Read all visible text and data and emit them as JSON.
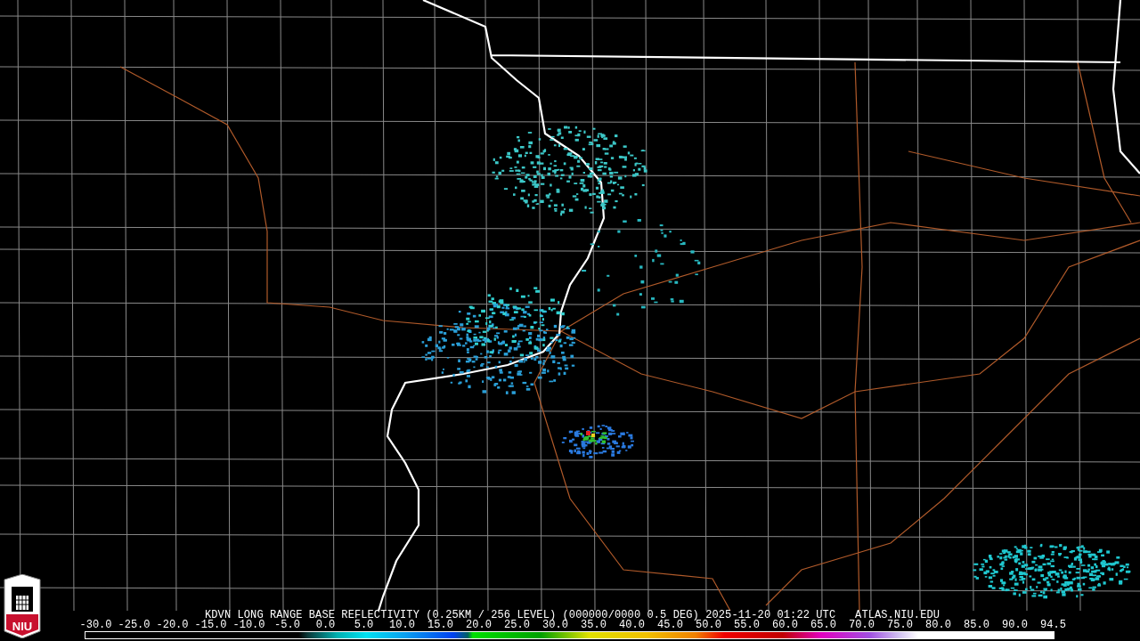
{
  "logo": {
    "text": "NIU"
  },
  "caption": "KDVN LONG RANGE BASE REFLECTIVITY (0.25KM / 256 LEVEL) (000000/0000 0.5 DEG) 2025-11-20 01:22 UTC   ATLAS.NIU.EDU",
  "scale": {
    "ticks": [
      "-30.0",
      "-25.0",
      "-20.0",
      "-15.0",
      "-10.0",
      "-5.0",
      "0.0",
      "5.0",
      "10.0",
      "15.0",
      "20.0",
      "25.0",
      "30.0",
      "35.0",
      "40.0",
      "45.0",
      "50.0",
      "55.0",
      "60.0",
      "65.0",
      "70.0",
      "75.0",
      "80.0",
      "85.0",
      "90.0",
      "94.5"
    ]
  }
}
